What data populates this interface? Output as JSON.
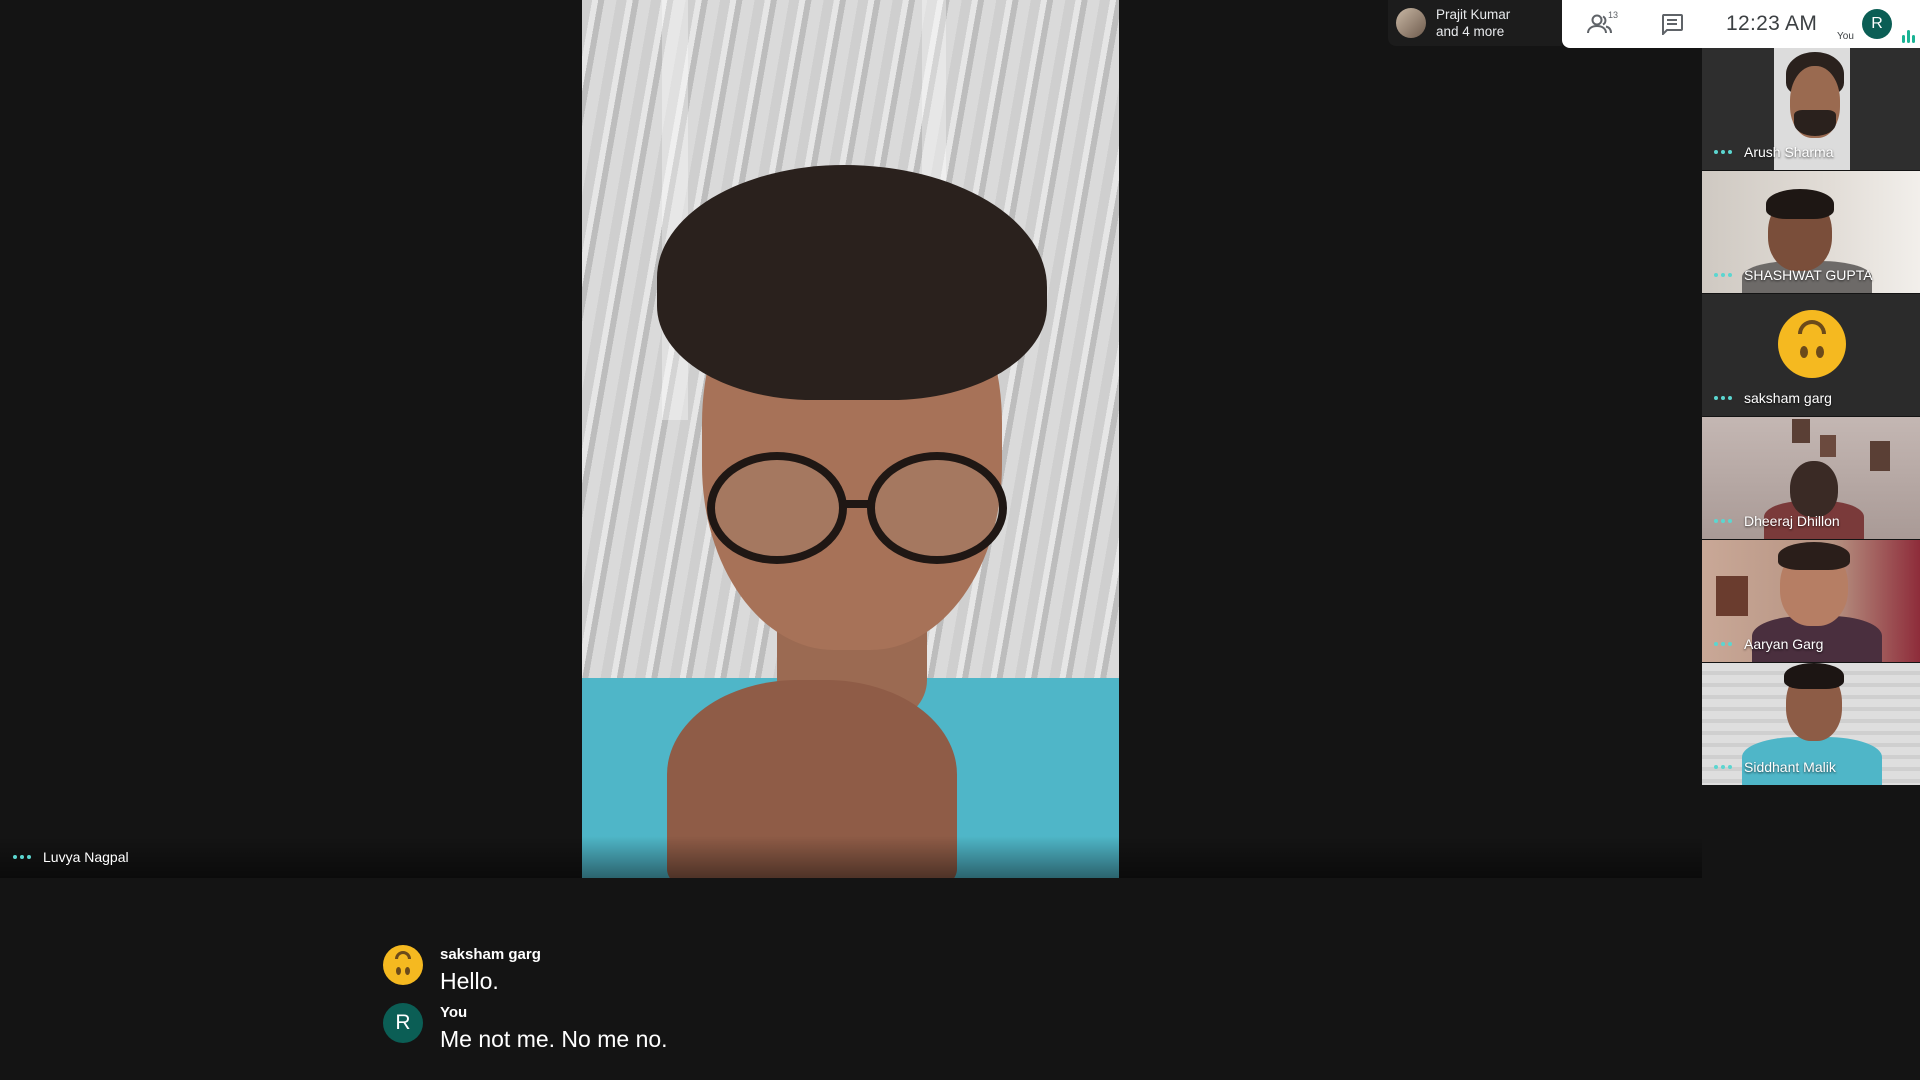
{
  "presenter": {
    "name": "Prajit Kumar",
    "others": "and 4 more"
  },
  "topbar": {
    "participants_icon": "people-icon",
    "participant_count": "13",
    "chat_icon": "chat-icon",
    "time": "12:23 AM",
    "user_initial": "R",
    "user_label": "You"
  },
  "main_speaker": {
    "name": "Luvya Nagpal",
    "menu_icon": "more-options-icon"
  },
  "tiles": [
    {
      "name": "Arush Sharma"
    },
    {
      "name": "SHASHWAT GUPTA"
    },
    {
      "name": "saksham garg"
    },
    {
      "name": "Dheeraj Dhillon"
    },
    {
      "name": "Aaryan Garg"
    },
    {
      "name": "Siddhant Malik"
    }
  ],
  "captions": [
    {
      "speaker": "saksham garg",
      "text": "Hello.",
      "avatar": "upside-down-face-emoji"
    },
    {
      "speaker": "You",
      "text": "Me not me. No me no.",
      "initial": "R"
    }
  ],
  "colors": {
    "background": "#141414",
    "accent": "#5bd6d0",
    "user_avatar": "#0b5e55",
    "topbar": "#ffffff"
  }
}
